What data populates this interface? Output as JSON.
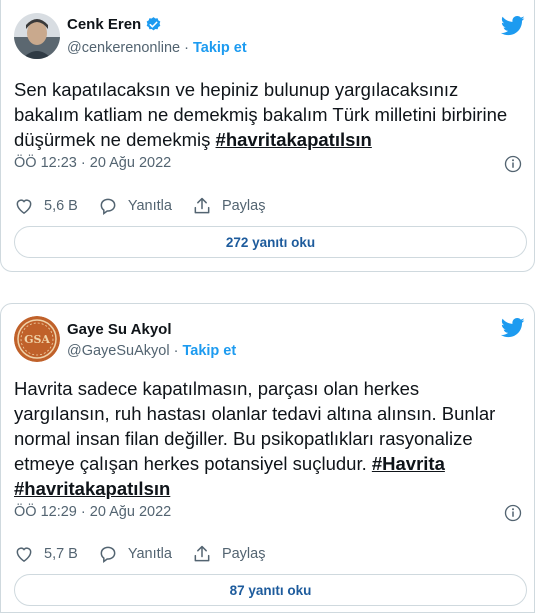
{
  "tweets": [
    {
      "author": "Cenk Eren",
      "handle": "@cenkerenonline",
      "separator": "·",
      "follow": "Takip et",
      "text_plain": "Sen kapatılacaksın ve hepiniz bulunup yargılacaksınız bakalım katliam ne demekmiş bakalım Türk milletini birbirine düşürmek ne demekmiş ",
      "hashtags": [
        "#havritakapatılsın"
      ],
      "time": "ÖÖ 12:23 · 20 Ağu 2022",
      "likes": "5,6 B",
      "reply_label": "Yanıtla",
      "share_label": "Paylaş",
      "replies_button": "272 yanıtı oku",
      "verified": true
    },
    {
      "author": "Gaye Su Akyol",
      "handle": "@GayeSuAkyol",
      "separator": "·",
      "follow": "Takip et",
      "text_plain": "Havrita sadece kapatılmasın, parçası olan herkes yargılansın, ruh hastası olanlar tedavi altına alınsın. Bunlar normal insan filan değiller. Bu psikopatlıkları rasyonalize etmeye çalışan herkes potansiyel suçludur. ",
      "hashtags": [
        "#Havrita",
        "#havritakapatılsın"
      ],
      "avatar_initials": "GSA",
      "time": "ÖÖ 12:29 · 20 Ağu 2022",
      "likes": "5,7 B",
      "reply_label": "Yanıtla",
      "share_label": "Paylaş",
      "replies_button": "87 yanıtı oku",
      "verified": false
    }
  ],
  "colors": {
    "accent": "#1d9bf0",
    "border": "#cfd9de",
    "muted": "#536471",
    "text": "#0f1419"
  }
}
